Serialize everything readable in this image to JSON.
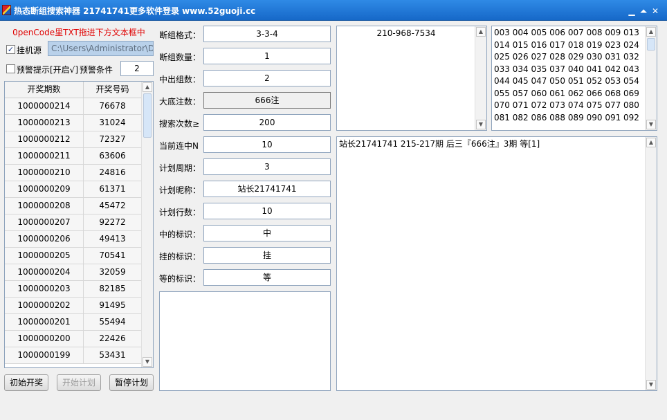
{
  "window": {
    "title": "热态断组搜索神器 21741741更多软件登录 www.52guoji.cc",
    "minimize_glyph": "▁",
    "maximize_glyph": "⏶",
    "close_glyph": "✕"
  },
  "left_panel": {
    "hint": "0penCode里TXT拖进下方文本框中",
    "source_checkbox": {
      "label": "挂机源",
      "checked": true,
      "glyph": "✓"
    },
    "source_path": "C:\\Users\\Administrator\\Do",
    "warning_checkbox": {
      "label": "预警提示[开启√]",
      "checked": false
    },
    "warning_condition_label": "预警条件",
    "warning_condition_value": "2",
    "table": {
      "columns": [
        "开奖期数",
        "开奖号码"
      ],
      "rows": [
        [
          "1000000214",
          "76678"
        ],
        [
          "1000000213",
          "31024"
        ],
        [
          "1000000212",
          "72327"
        ],
        [
          "1000000211",
          "63606"
        ],
        [
          "1000000210",
          "24816"
        ],
        [
          "1000000209",
          "61371"
        ],
        [
          "1000000208",
          "45472"
        ],
        [
          "1000000207",
          "92272"
        ],
        [
          "1000000206",
          "49413"
        ],
        [
          "1000000205",
          "70541"
        ],
        [
          "1000000204",
          "32059"
        ],
        [
          "1000000203",
          "82185"
        ],
        [
          "1000000202",
          "91495"
        ],
        [
          "1000000201",
          "55494"
        ],
        [
          "1000000200",
          "22426"
        ],
        [
          "1000000199",
          "53431"
        ]
      ]
    },
    "buttons": {
      "start_draw": "初始开奖",
      "start_plan": "开始计划",
      "pause_plan": "暂停计划"
    }
  },
  "form": [
    {
      "label": "断组格式：",
      "value": "3-3-4"
    },
    {
      "label": "断组数量：",
      "value": "1"
    },
    {
      "label": "中出组数：",
      "value": "2"
    },
    {
      "label": "大底注数：",
      "value": "666注"
    },
    {
      "label": "搜索次数≥",
      "value": "200"
    },
    {
      "label": "当前连中N",
      "value": "10"
    },
    {
      "label": "计划周期：",
      "value": "3"
    },
    {
      "label": "计划昵称：",
      "value": "站长21741741"
    },
    {
      "label": "计划行数：",
      "value": "10"
    },
    {
      "label": "中的标识：",
      "value": "中"
    },
    {
      "label": "挂的标识：",
      "value": "挂"
    },
    {
      "label": "等的标识：",
      "value": "等"
    }
  ],
  "top_middle_text": "210-968-7534",
  "numbers_pane": [
    "003 004 005 006 007 008 009 013",
    "014 015 016 017 018 019 023 024",
    "025 026 027 028 029 030 031 032",
    "033 034 035 037 040 041 042 043",
    "044 045 047 050 051 052 053 054",
    "055 057 060 061 062 066 068 069",
    "070 071 072 073 074 075 077 080",
    "081 082 086 088 089 090 091 092"
  ],
  "plan_output": "站长21741741 215-217期 后三『666注』3期 等[1]",
  "icons": {
    "scroll_up": "▲",
    "scroll_down": "▼"
  }
}
